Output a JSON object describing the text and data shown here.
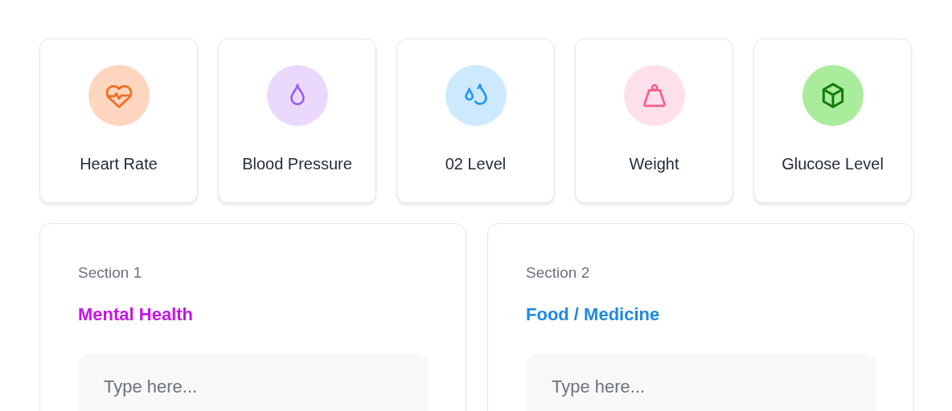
{
  "metrics": [
    {
      "label": "Heart Rate",
      "kind": "heart",
      "color": "#f56a1d"
    },
    {
      "label": "Blood Pressure",
      "kind": "drop",
      "color": "#9b5cf0"
    },
    {
      "label": "02 Level",
      "kind": "drops",
      "color": "#2196f3"
    },
    {
      "label": "Weight",
      "kind": "weight",
      "color": "#f75c8c"
    },
    {
      "label": "Glucose Level",
      "kind": "cube",
      "color": "#137c0b"
    }
  ],
  "sections": [
    {
      "label": "Section 1",
      "title": "Mental Health",
      "color": "#c416ea",
      "placeholder": "Type here..."
    },
    {
      "label": "Section 2",
      "title": "Food / Medicine",
      "color": "#1e88e5",
      "placeholder": "Type here..."
    }
  ]
}
